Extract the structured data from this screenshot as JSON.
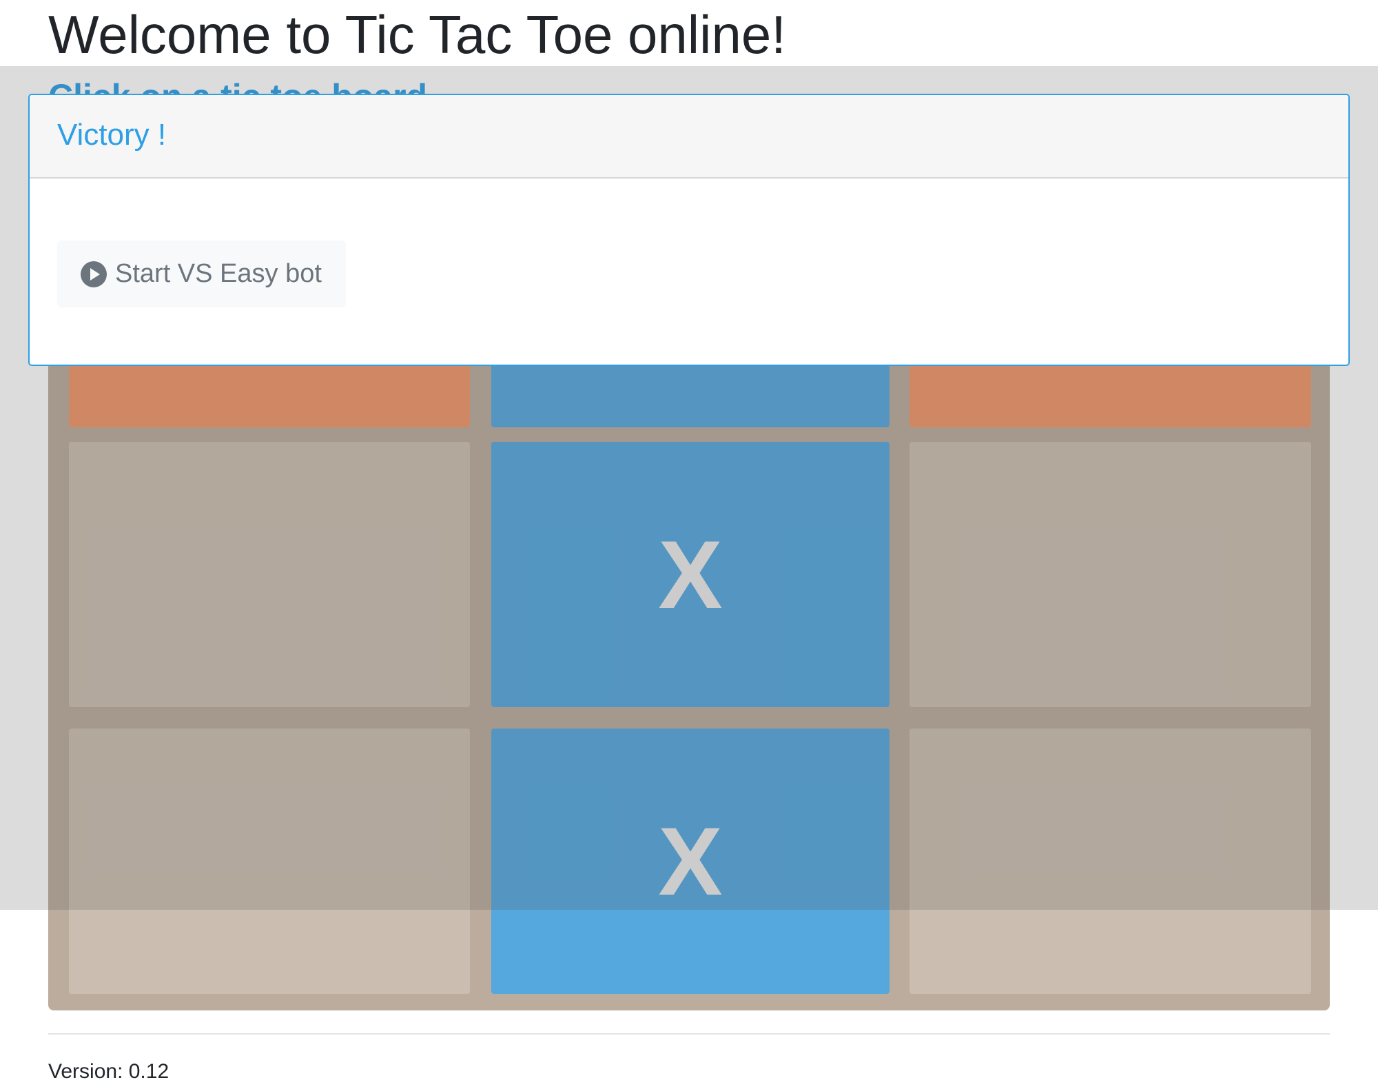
{
  "header": {
    "title": "Welcome to Tic Tac Toe online!",
    "subtitle": "Click on a tic toe board"
  },
  "board": {
    "cells": [
      {
        "row": 0,
        "col": 0,
        "mark": "",
        "state": "o"
      },
      {
        "row": 0,
        "col": 1,
        "mark": "",
        "state": "x"
      },
      {
        "row": 0,
        "col": 2,
        "mark": "",
        "state": "o"
      },
      {
        "row": 1,
        "col": 0,
        "mark": "",
        "state": "empty"
      },
      {
        "row": 1,
        "col": 1,
        "mark": "X",
        "state": "x"
      },
      {
        "row": 1,
        "col": 2,
        "mark": "",
        "state": "empty"
      },
      {
        "row": 2,
        "col": 0,
        "mark": "",
        "state": "empty"
      },
      {
        "row": 2,
        "col": 1,
        "mark": "X",
        "state": "x"
      },
      {
        "row": 2,
        "col": 2,
        "mark": "",
        "state": "empty"
      }
    ]
  },
  "modal": {
    "title": "Victory !",
    "start_button_label": "Start VS Easy bot",
    "start_button_icon": "play-circle-icon"
  },
  "footer": {
    "version": "Version: 0.12"
  },
  "colors": {
    "accent": "#2e9fe5",
    "x_cell": "#55a8de",
    "o_cell": "#f0976a",
    "empty_cell": "#cbbeb0",
    "board": "#bbac9e"
  }
}
